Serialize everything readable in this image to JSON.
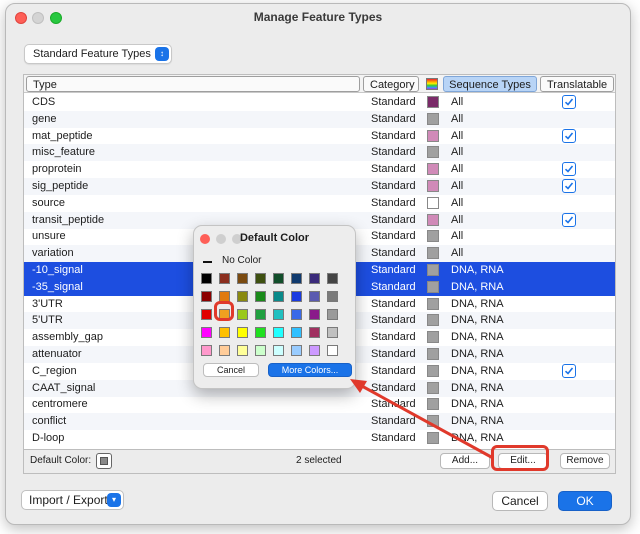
{
  "window": {
    "title": "Manage Feature Types"
  },
  "feature_set": {
    "selected": "Standard Feature Types"
  },
  "table": {
    "headers": {
      "type": "Type",
      "category": "Category",
      "sequence_types": "Sequence Types",
      "translatable": "Translatable"
    },
    "rows": [
      {
        "type": "CDS",
        "category": "Standard",
        "color": "#7a2a68",
        "seq": "All",
        "translatable": true,
        "selected": false
      },
      {
        "type": "gene",
        "category": "Standard",
        "color": "#a0a0a0",
        "seq": "All",
        "translatable": false,
        "selected": false
      },
      {
        "type": "mat_peptide",
        "category": "Standard",
        "color": "#d08ab8",
        "seq": "All",
        "translatable": true,
        "selected": false
      },
      {
        "type": "misc_feature",
        "category": "Standard",
        "color": "#a0a0a0",
        "seq": "All",
        "translatable": false,
        "selected": false
      },
      {
        "type": "proprotein",
        "category": "Standard",
        "color": "#d08ab8",
        "seq": "All",
        "translatable": true,
        "selected": false
      },
      {
        "type": "sig_peptide",
        "category": "Standard",
        "color": "#d08ab8",
        "seq": "All",
        "translatable": true,
        "selected": false
      },
      {
        "type": "source",
        "category": "Standard",
        "color": "#ffffff",
        "seq": "All",
        "translatable": false,
        "selected": false
      },
      {
        "type": "transit_peptide",
        "category": "Standard",
        "color": "#d08ab8",
        "seq": "All",
        "translatable": true,
        "selected": false
      },
      {
        "type": "unsure",
        "category": "Standard",
        "color": "#a0a0a0",
        "seq": "All",
        "translatable": false,
        "selected": false
      },
      {
        "type": "variation",
        "category": "Standard",
        "color": "#a0a0a0",
        "seq": "All",
        "translatable": false,
        "selected": false
      },
      {
        "type": "-10_signal",
        "category": "Standard",
        "color": "#a0a0a0",
        "seq": "DNA, RNA",
        "translatable": false,
        "selected": true
      },
      {
        "type": "-35_signal",
        "category": "Standard",
        "color": "#a0a0a0",
        "seq": "DNA, RNA",
        "translatable": false,
        "selected": true
      },
      {
        "type": "3'UTR",
        "category": "Standard",
        "color": "#a0a0a0",
        "seq": "DNA, RNA",
        "translatable": false,
        "selected": false
      },
      {
        "type": "5'UTR",
        "category": "Standard",
        "color": "#a0a0a0",
        "seq": "DNA, RNA",
        "translatable": false,
        "selected": false
      },
      {
        "type": "assembly_gap",
        "category": "Standard",
        "color": "#a0a0a0",
        "seq": "DNA, RNA",
        "translatable": false,
        "selected": false
      },
      {
        "type": "attenuator",
        "category": "Standard",
        "color": "#a0a0a0",
        "seq": "DNA, RNA",
        "translatable": false,
        "selected": false
      },
      {
        "type": "C_region",
        "category": "Standard",
        "color": "#a0a0a0",
        "seq": "DNA, RNA",
        "translatable": true,
        "selected": false
      },
      {
        "type": "CAAT_signal",
        "category": "Standard",
        "color": "#a0a0a0",
        "seq": "DNA, RNA",
        "translatable": false,
        "selected": false
      },
      {
        "type": "centromere",
        "category": "Standard",
        "color": "#a0a0a0",
        "seq": "DNA, RNA",
        "translatable": false,
        "selected": false
      },
      {
        "type": "conflict",
        "category": "Standard",
        "color": "#a0a0a0",
        "seq": "DNA, RNA",
        "translatable": false,
        "selected": false
      },
      {
        "type": "D-loop",
        "category": "Standard",
        "color": "#a0a0a0",
        "seq": "DNA, RNA",
        "translatable": false,
        "selected": false
      }
    ]
  },
  "footer": {
    "default_color_label": "Default Color:",
    "selected_count": "2 selected",
    "add_label": "Add...",
    "edit_label": "Edit...",
    "remove_label": "Remove"
  },
  "bottom": {
    "import_export_label": "Import / Export",
    "cancel_label": "Cancel",
    "ok_label": "OK"
  },
  "palette": {
    "title": "Default Color",
    "no_color_label": "No Color",
    "cancel_label": "Cancel",
    "more_colors_label": "More Colors...",
    "selected_swatch": "orange",
    "swatches": [
      [
        "#000000",
        "#8b2e1e",
        "#7a4a10",
        "#3e5010",
        "#124e2a",
        "#103a6e",
        "#3a2a7a",
        "#444444"
      ],
      [
        "#8b0000",
        "#e07a10",
        "#8a8a10",
        "#1a8a1a",
        "#0a8a8a",
        "#1a3ae0",
        "#5a5ab0",
        "#7a7a7a"
      ],
      [
        "#e00000",
        "#f0a020",
        "#9ac81a",
        "#20a040",
        "#20c0c0",
        "#3a6ae8",
        "#8a1a8a",
        "#9a9a9a"
      ],
      [
        "#ff00ff",
        "#ffc000",
        "#ffff00",
        "#20e020",
        "#20ffff",
        "#30c0ff",
        "#a03060",
        "#c0c0c0"
      ],
      [
        "#ff99cc",
        "#ffcc99",
        "#ffff99",
        "#ccffcc",
        "#ccffff",
        "#99ccff",
        "#cc99ff",
        "#ffffff"
      ]
    ]
  }
}
